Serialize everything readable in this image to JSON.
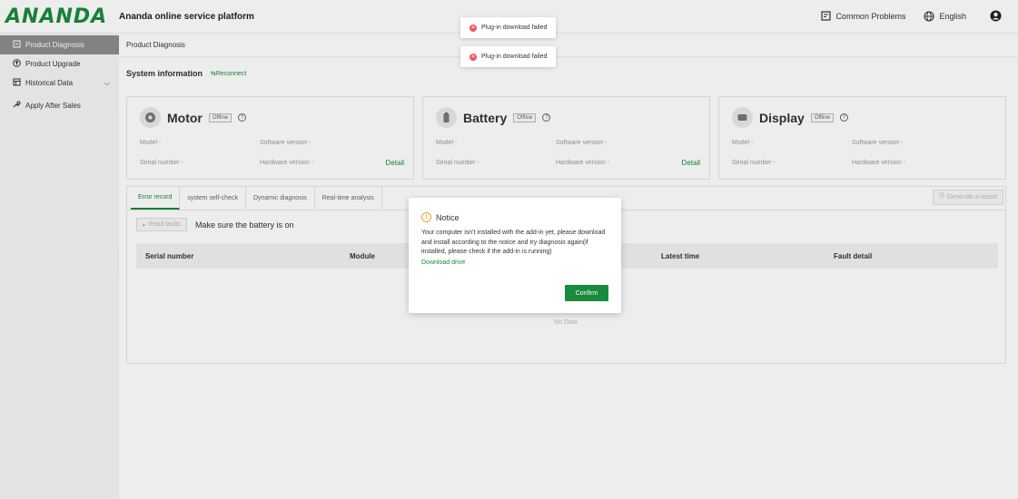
{
  "header": {
    "logo": "ANANDA",
    "title": "Ananda online service platform",
    "common_problems": "Common Problems",
    "language": "English"
  },
  "sidebar": {
    "items": [
      {
        "label": "Product Diagnosis",
        "icon": "diagnosis-icon"
      },
      {
        "label": "Product Upgrade",
        "icon": "upgrade-icon"
      },
      {
        "label": "Historical Data",
        "icon": "history-icon"
      },
      {
        "label": "Apply After Sales",
        "icon": "after-sales-icon"
      }
    ],
    "collapse": "<"
  },
  "breadcrumb": "Product Diagnosis",
  "system_info": {
    "title": "System information",
    "reconnect": "⇆Reconnect"
  },
  "cards": [
    {
      "name": "Motor",
      "status": "Offline",
      "model": "Model -",
      "software": "Software version -",
      "serial": "Serial number -",
      "hardware": "Hardware version -",
      "detail": "Detail"
    },
    {
      "name": "Battery",
      "status": "Offline",
      "model": "Model -",
      "software": "Software version -",
      "serial": "Serial number -",
      "hardware": "Hardware version -",
      "detail": "Detail"
    },
    {
      "name": "Display",
      "status": "Offline",
      "model": "Model -",
      "software": "Software version -",
      "serial": "Serial number -",
      "hardware": "Hardware version -"
    }
  ],
  "tabs": [
    "Error record",
    "system self-check",
    "Dynamic diagnosis",
    "Real-time analysis"
  ],
  "generate_report": "Generate a report",
  "read_faults": "Read faults",
  "read_hint": "Make sure the battery is on",
  "table": {
    "columns": [
      "Serial number",
      "Module",
      "Latest time",
      "Fault detail"
    ],
    "empty": "No Data"
  },
  "toasts": [
    "Plug-in download failed",
    "Plug-in download failed"
  ],
  "modal": {
    "title": "Notice",
    "body": "Your computer isn't installed with the add-in yet, please download and install according to the notice and try diagnosis again(if installed, please check if the add-in is running)",
    "link": "Download drive",
    "confirm": "Confirm"
  },
  "colors": {
    "brand": "#1a8a3c",
    "error": "#f2545b",
    "warning": "#f0a020"
  }
}
